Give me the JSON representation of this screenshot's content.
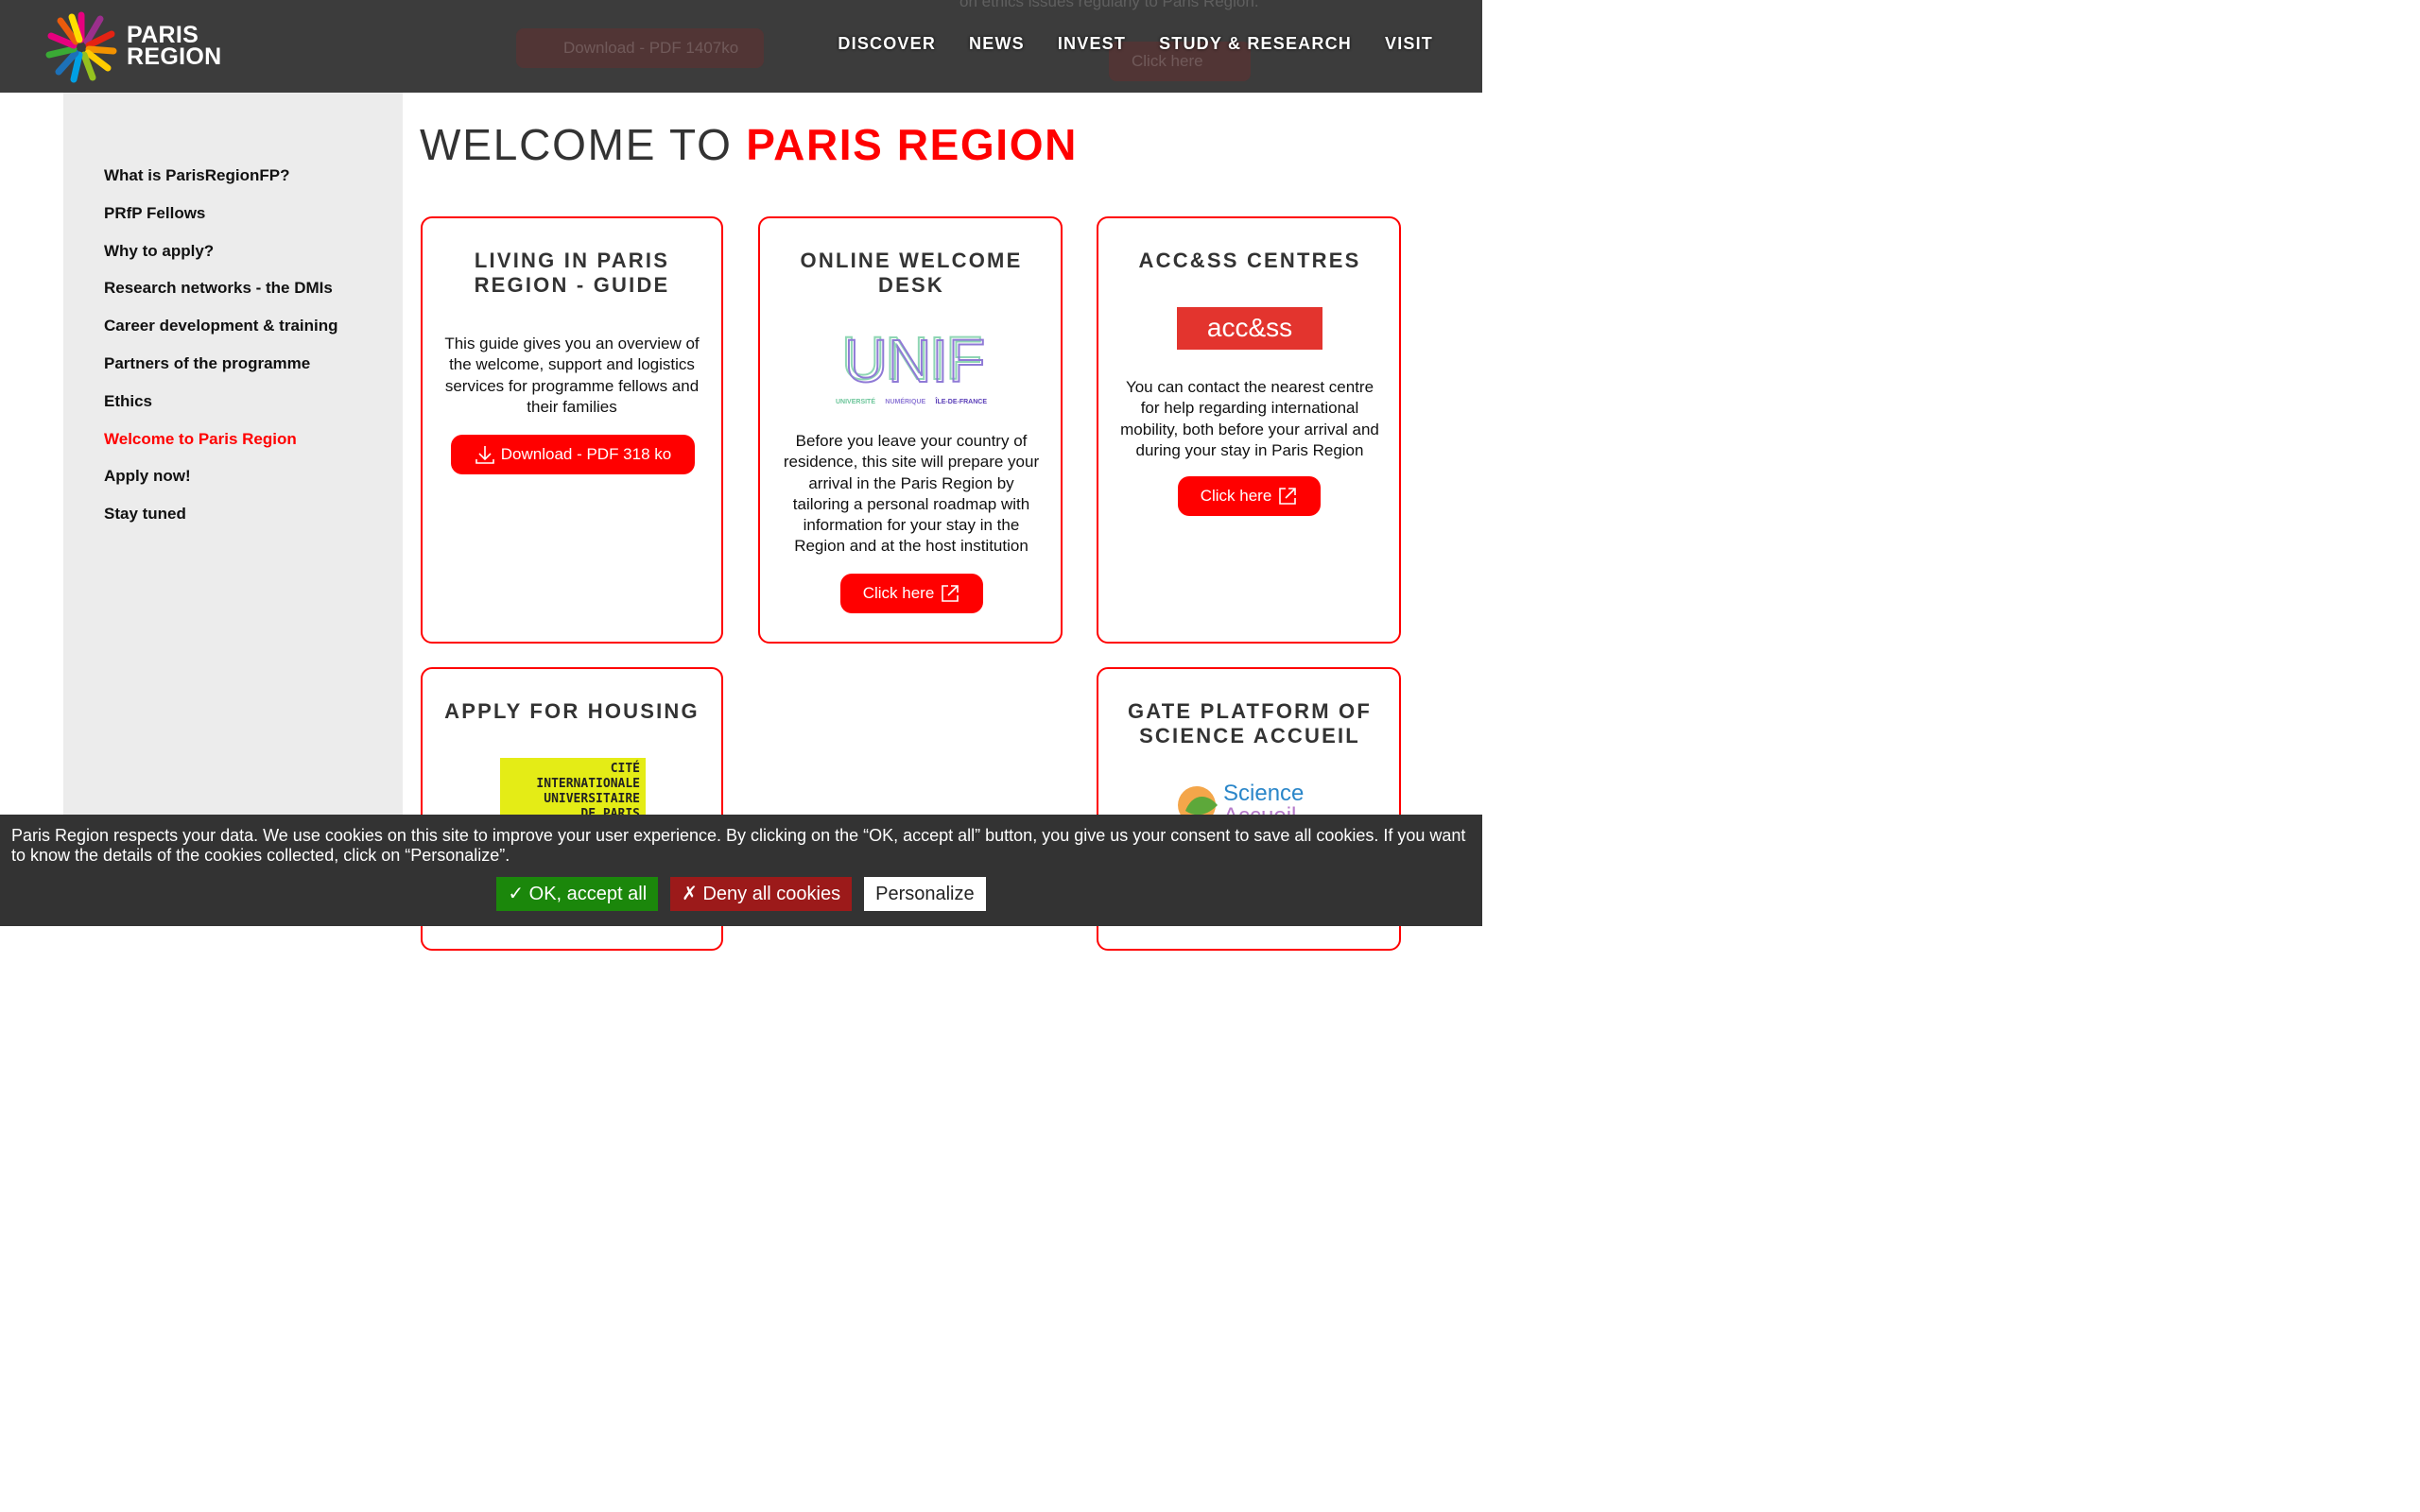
{
  "header": {
    "logo_line1": "PARIS",
    "logo_line2": "REGION",
    "nav": [
      "DISCOVER",
      "NEWS",
      "INVEST",
      "STUDY & RESEARCH",
      "VISIT"
    ],
    "background_ghost": {
      "download_label": "Download - PDF 1407ko",
      "click_label": "Click here",
      "text": "on ethics issues regularly to Paris Region."
    }
  },
  "sidebar": {
    "items": [
      {
        "label": "What is ParisRegionFP?",
        "active": false
      },
      {
        "label": "PRfP Fellows",
        "active": false
      },
      {
        "label": "Why to apply?",
        "active": false
      },
      {
        "label": "Research networks - the DMIs",
        "active": false
      },
      {
        "label": "Career development & training",
        "active": false
      },
      {
        "label": "Partners of the programme",
        "active": false
      },
      {
        "label": "Ethics",
        "active": false
      },
      {
        "label": "Welcome to Paris Region",
        "active": true
      },
      {
        "label": "Apply now!",
        "active": false
      },
      {
        "label": "Stay tuned",
        "active": false
      }
    ]
  },
  "main": {
    "title_prefix": "WELCOME TO",
    "title_highlight": "PARIS REGION",
    "cards": {
      "guide": {
        "title": "LIVING IN PARIS REGION - GUIDE",
        "text": "This guide gives you an overview of the welcome, support and logistics services for programme fellows and their families",
        "button": "Download - PDF 318 ko"
      },
      "desk": {
        "title": "ONLINE WELCOME DESK",
        "logo_word": "UNIF",
        "logo_sub": [
          "UNIVERSITÉ",
          "NUMÉRIQUE",
          "ÎLE-DE-FRANCE"
        ],
        "text": "Before you leave your country of residence, this site will prepare your arrival in the Paris Region by tailoring a personal roadmap with information for your stay in the Region and at the host institution",
        "button": "Click here"
      },
      "access": {
        "title": "ACC&SS CENTRES",
        "logo_word": "acc&ss",
        "text": "You can contact the nearest centre for help regarding international mobility, both before your arrival and during your stay in Paris Region",
        "button": "Click here"
      },
      "housing": {
        "title": "APPLY FOR HOUSING",
        "logo_lines": [
          "CITÉ",
          "INTERNATIONALE",
          "UNIVERSITAIRE",
          "DE PARIS"
        ]
      },
      "gate": {
        "title": "GATE PLATFORM OF SCIENCE ACCUEIL",
        "logo_word1": "Science",
        "logo_word2": "Accueil"
      }
    }
  },
  "cookie": {
    "text": "Paris Region respects your data. We use cookies on this site to improve your user experience. By clicking on the “OK, accept all” button, you give us your consent to save all cookies. If you want to know the details of the cookies collected, click on “Personalize”.",
    "ok": "✓ OK, accept all",
    "deny": "✗ Deny all cookies",
    "personalize": "Personalize"
  },
  "colors": {
    "accent": "#ff0000",
    "header_bg": "#3c3c3c",
    "sidebar_bg": "#ececec",
    "cookie_bg": "#333333",
    "ok_green": "#1b870b",
    "deny_red": "#9c1a1a"
  }
}
